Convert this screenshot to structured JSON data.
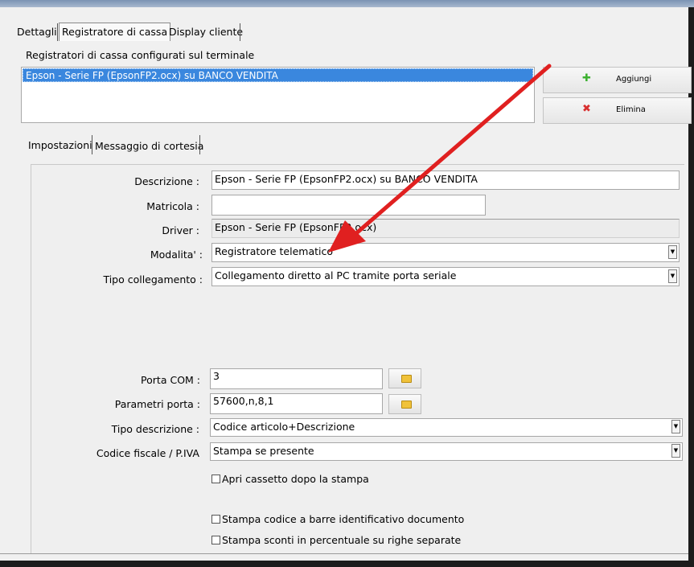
{
  "tabs": [
    "Dettagli",
    "Registratore di cassa",
    "Display cliente"
  ],
  "terminal_section_label": "Registratori di cassa configurati sul terminale",
  "registers": [
    "Epson - Serie FP (EpsonFP2.ocx) su BANCO VENDITA"
  ],
  "buttons": {
    "add": "Aggiungi",
    "delete": "Elimina"
  },
  "subtabs": [
    "Impostazioni",
    "Messaggio di cortesia"
  ],
  "form": {
    "descrizione_label": "Descrizione :",
    "descrizione_value": "Epson - Serie FP (EpsonFP2.ocx) su BANCO VENDITA",
    "matricola_label": "Matricola :",
    "matricola_value": "",
    "driver_label": "Driver :",
    "driver_value": "Epson - Serie FP (EpsonFP2.ocx)",
    "modalita_label": "Modalita' :",
    "modalita_value": "Registratore telematico",
    "tipo_collegamento_label": "Tipo collegamento :",
    "tipo_collegamento_value": "Collegamento diretto al PC tramite porta seriale",
    "porta_com_label": "Porta COM :",
    "porta_com_value": "3",
    "parametri_porta_label": "Parametri porta :",
    "parametri_porta_value": "57600,n,8,1",
    "tipo_descrizione_label": "Tipo descrizione :",
    "tipo_descrizione_value": "Codice articolo+Descrizione",
    "codice_fiscale_label": "Codice fiscale / P.IVA",
    "codice_fiscale_value": "Stampa se presente"
  },
  "checkboxes": {
    "apri_cassetto": "Apri cassetto dopo la stampa",
    "stampa_barcode": "Stampa codice a barre identificativo documento",
    "stampa_sconti": "Stampa sconti in percentuale su righe separate"
  },
  "icons": {
    "add": "plus-icon",
    "delete": "x-icon",
    "browse": "folder-icon",
    "dropdown": "chevron-down-icon"
  },
  "colors": {
    "selection": "#3a87de",
    "annotation_arrow": "#e02020",
    "add_icon": "#3cb030",
    "delete_icon": "#d83030"
  }
}
